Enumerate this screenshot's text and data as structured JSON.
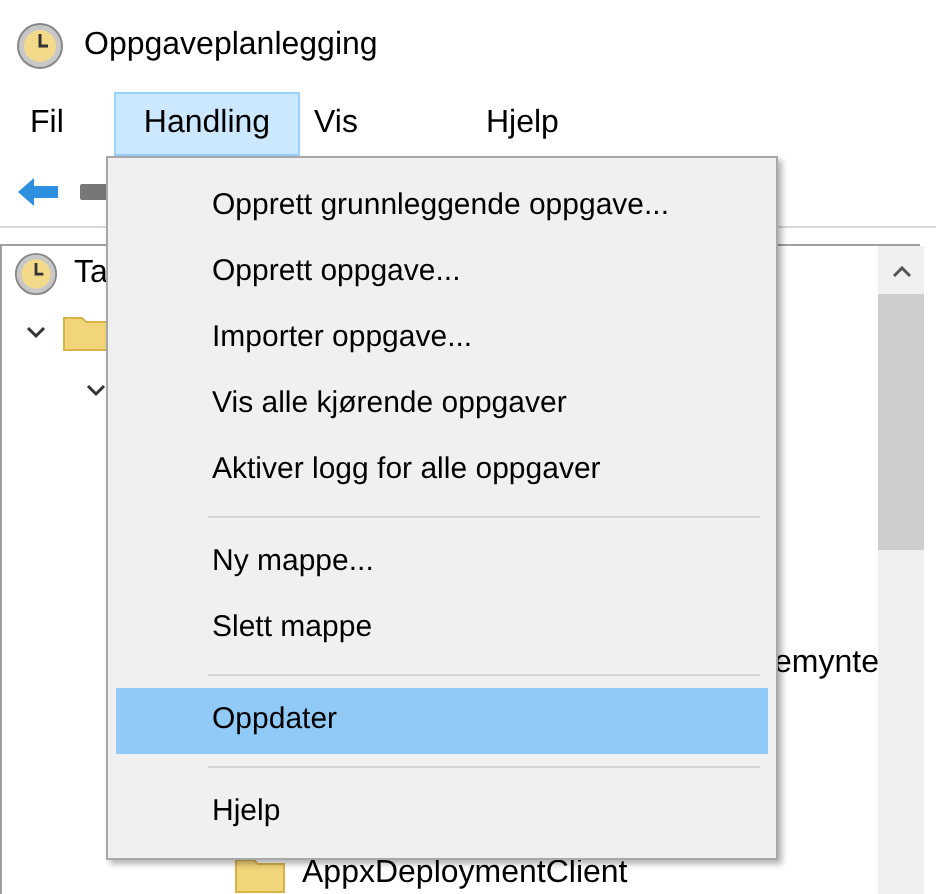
{
  "window": {
    "title": "Oppgaveplanlegging"
  },
  "menu_bar": [
    {
      "label": "Fil",
      "selected": false
    },
    {
      "label": "Handling",
      "selected": true
    },
    {
      "label": "Vis",
      "selected": false
    },
    {
      "label": "Hjelp",
      "selected": false
    }
  ],
  "tree": [
    {
      "label": "Ta",
      "kind": "clock",
      "children": [
        {
          "kind": "folder",
          "expanded": true,
          "children": [
            {
              "expanded": true,
              "children": [
                {
                  "label": "emynte",
                  "kind": "fragment"
                },
                {
                  "label": "AppxDeploymentClient",
                  "kind": "folder"
                }
              ]
            }
          ]
        }
      ]
    }
  ],
  "dropdown": [
    {
      "kind": "item",
      "label": "Opprett grunnleggende oppgave...",
      "selected": false
    },
    {
      "kind": "item",
      "label": "Opprett oppgave...",
      "selected": false
    },
    {
      "kind": "item",
      "label": "Importer oppgave...",
      "selected": false
    },
    {
      "kind": "item",
      "label": "Vis alle kjørende oppgaver",
      "selected": false
    },
    {
      "kind": "item",
      "label": "Aktiver logg for alle oppgaver",
      "selected": false
    },
    {
      "kind": "separator"
    },
    {
      "kind": "item",
      "label": "Ny mappe...",
      "selected": false
    },
    {
      "kind": "item",
      "label": "Slett mappe",
      "selected": false
    },
    {
      "kind": "separator"
    },
    {
      "kind": "item",
      "label": "Oppdater",
      "selected": true
    },
    {
      "kind": "separator"
    },
    {
      "kind": "item",
      "label": "Hjelp",
      "selected": false
    }
  ]
}
